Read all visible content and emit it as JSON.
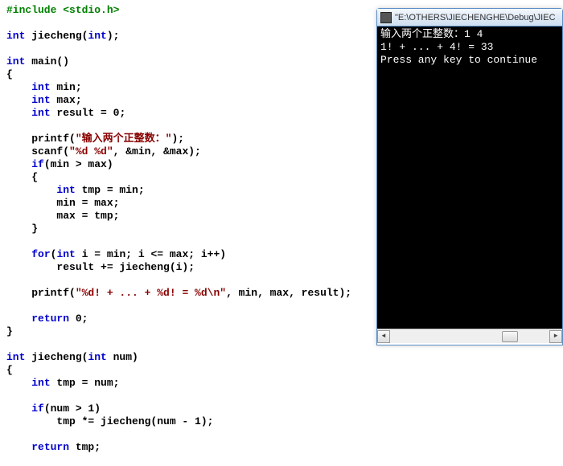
{
  "code": {
    "l1a": "#include ",
    "l1b": "<stdio.h>",
    "l2a": "int",
    "l2b": " jiecheng(",
    "l2c": "int",
    "l2d": ");",
    "l3a": "int",
    "l3b": " main()",
    "l4": "{",
    "l5a": "    ",
    "l5b": "int",
    "l5c": " min;",
    "l6a": "    ",
    "l6b": "int",
    "l6c": " max;",
    "l7a": "    ",
    "l7b": "int",
    "l7c": " result = 0;",
    "l8a": "    printf(",
    "l8b": "\"输入两个正整数：\"",
    "l8c": ");",
    "l9a": "    scanf(",
    "l9b": "\"%d %d\"",
    "l9c": ", &min, &max);",
    "l10a": "    ",
    "l10b": "if",
    "l10c": "(min > max)",
    "l11": "    {",
    "l12a": "        ",
    "l12b": "int",
    "l12c": " tmp = min;",
    "l13": "        min = max;",
    "l14": "        max = tmp;",
    "l15": "    }",
    "l16a": "    ",
    "l16b": "for",
    "l16c": "(",
    "l16d": "int",
    "l16e": " i = min; i <= max; i++)",
    "l17": "        result += jiecheng(i);",
    "l18a": "    printf(",
    "l18b": "\"%d! + ... + %d! = %d\\n\"",
    "l18c": ", min, max, result);",
    "l19a": "    ",
    "l19b": "return",
    "l19c": " 0;",
    "l20": "}",
    "l21a": "int",
    "l21b": " jiecheng(",
    "l21c": "int",
    "l21d": " num)",
    "l22": "{",
    "l23a": "    ",
    "l23b": "int",
    "l23c": " tmp = num;",
    "l24a": "    ",
    "l24b": "if",
    "l24c": "(num > 1)",
    "l25": "        tmp *= jiecheng(num - 1);",
    "l26a": "    ",
    "l26b": "return",
    "l26c": " tmp;"
  },
  "console": {
    "title": "\"E:\\OTHERS\\JIECHENGHE\\Debug\\JIEC",
    "line1": "输入两个正整数：1 4",
    "line2": "1! + ... + 4! = 33",
    "line3": "Press any key to continue"
  }
}
